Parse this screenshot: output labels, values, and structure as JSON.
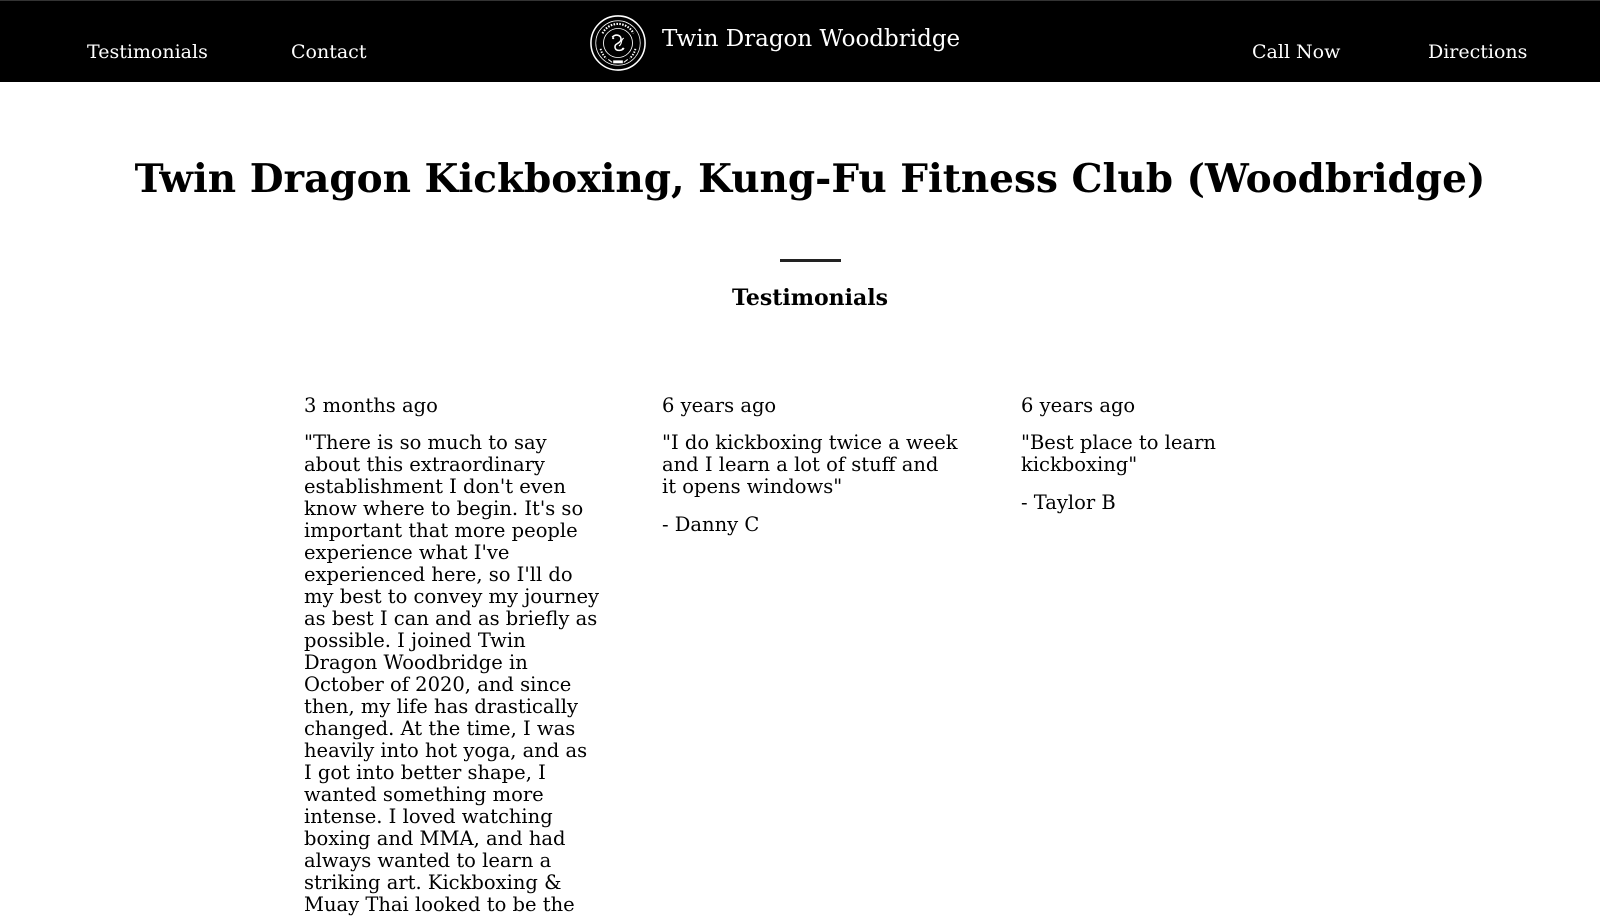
{
  "nav": {
    "left_links": [
      "Testimonials",
      "Contact"
    ],
    "brand_name": "Twin Dragon Woodbridge",
    "brand_logo_icon": "twin-dragon-club-seal",
    "right_links": [
      "Call Now",
      "Directions"
    ]
  },
  "main": {
    "title": "Twin Dragon Kickboxing, Kung-Fu Fitness Club (Woodbridge)",
    "section_heading": "Testimonials",
    "testimonials": [
      {
        "date": "3 months ago",
        "quote": "\"There is so much to say about this extraordinary establishment I don't even know where to begin. It's so important that more people experience what I've experienced here, so I'll do my best to convey my journey as best I can and as briefly as possible. I joined Twin Dragon Woodbridge in October of 2020, and since then, my life has drastically changed. At the time, I was heavily into hot yoga, and as I got into better shape, I wanted something more intense. I loved watching boxing and MMA, and had always wanted to learn a striking art. Kickboxing & Muay Thai looked to be the",
        "author": ""
      },
      {
        "date": "6 years ago",
        "quote": "\"I do kickboxing twice a week and I learn a lot of stuff and it opens windows\"",
        "author": "- Danny C"
      },
      {
        "date": "6 years ago",
        "quote": "\"Best place to learn kickboxing\"",
        "author": "- Taylor B"
      }
    ]
  },
  "colors": {
    "navbar_background": "#000000",
    "navbar_text": "#ffffff",
    "page_background": "#ffffff",
    "body_text": "#000000"
  }
}
